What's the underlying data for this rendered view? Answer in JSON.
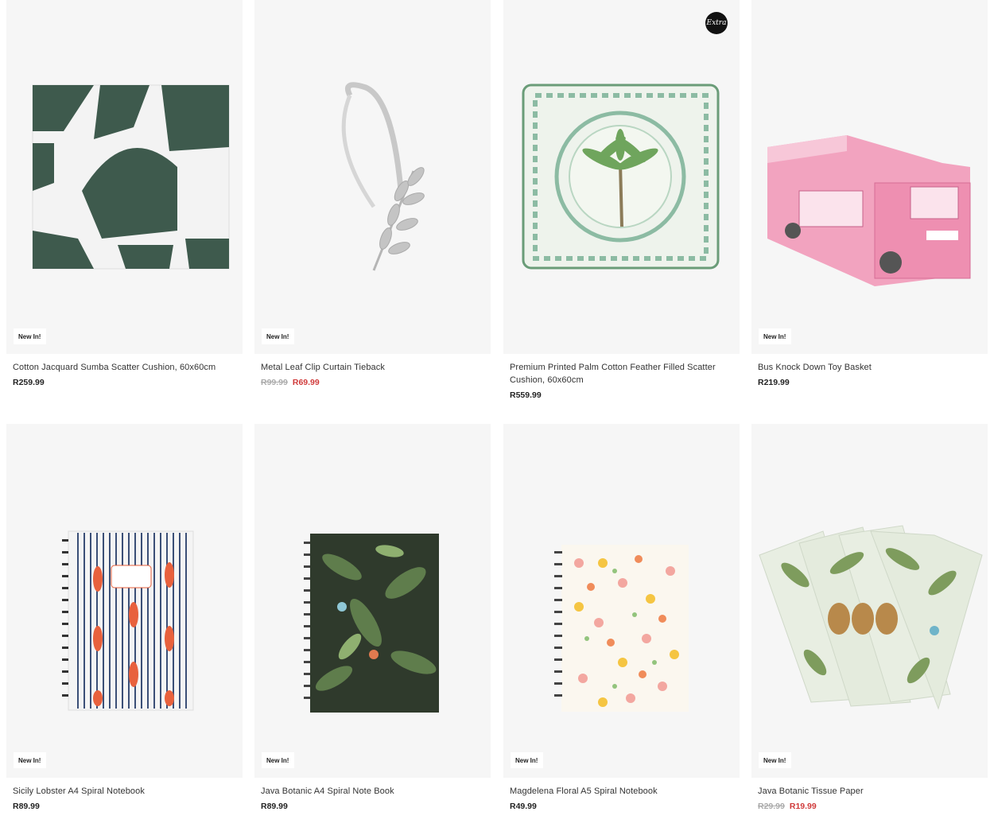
{
  "products": [
    {
      "title": "Cotton Jacquard Sumba Scatter Cushion, 60x60cm",
      "badge": "New In!",
      "price": "R259.99",
      "was": "",
      "now": ""
    },
    {
      "title": "Metal Leaf Clip Curtain Tieback",
      "badge": "New In!",
      "price": "",
      "was": "R99.99",
      "now": "R69.99"
    },
    {
      "title": "Premium Printed Palm Cotton Feather Filled Scatter Cushion, 60x60cm",
      "badge": "",
      "price": "R559.99",
      "was": "",
      "now": "",
      "logo": "Extra"
    },
    {
      "title": "Bus Knock Down Toy Basket",
      "badge": "New In!",
      "price": "R219.99",
      "was": "",
      "now": ""
    },
    {
      "title": "Sicily Lobster A4 Spiral Notebook",
      "badge": "New In!",
      "price": "R89.99",
      "was": "",
      "now": ""
    },
    {
      "title": "Java Botanic A4 Spiral Note Book",
      "badge": "New In!",
      "price": "R89.99",
      "was": "",
      "now": ""
    },
    {
      "title": "Magdelena Floral A5 Spiral Notebook",
      "badge": "New In!",
      "price": "R49.99",
      "was": "",
      "now": ""
    },
    {
      "title": "Java Botanic Tissue Paper",
      "badge": "New In!",
      "price": "",
      "was": "R29.99",
      "now": "R19.99"
    }
  ],
  "images": [
    "green-geometric-cushion",
    "silver-leaf-tieback",
    "palm-print-cushion",
    "pink-bus-toy-basket",
    "lobster-notebook",
    "botanic-notebook",
    "floral-notebook",
    "botanic-tissue-paper"
  ],
  "colors": {
    "tile_bg": "#f6f6f6",
    "sale_red": "#d03a3a",
    "strike_grey": "#aaaaaa"
  }
}
